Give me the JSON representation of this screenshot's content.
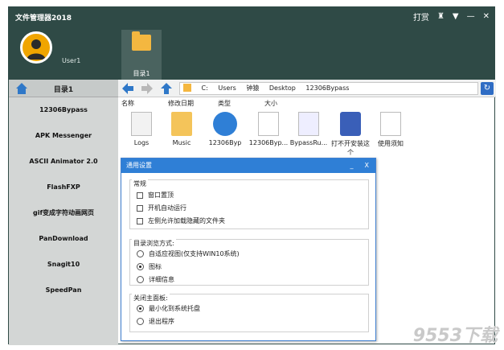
{
  "app": {
    "title": "文件管理器2018",
    "controls": {
      "skin_label": "打赏"
    },
    "user": {
      "name": "User1"
    },
    "tab": {
      "label": "目录1"
    }
  },
  "sidebar": {
    "header": "目录1",
    "items": [
      {
        "label": "12306Bypass"
      },
      {
        "label": "APK Messenger"
      },
      {
        "label": "ASCII Animator 2.0"
      },
      {
        "label": "FlashFXP"
      },
      {
        "label": "gif变成字符动画网页"
      },
      {
        "label": "PanDownload"
      },
      {
        "label": "Snagit10"
      },
      {
        "label": "SpeedPan"
      }
    ]
  },
  "path": {
    "segments": [
      "C:",
      "Users",
      "钟猿",
      "Desktop",
      "12306Bypass"
    ]
  },
  "columns": [
    "名称",
    "修改日期",
    "类型",
    "大小"
  ],
  "files": [
    {
      "name": "Logs",
      "kind": "folder"
    },
    {
      "name": "Music",
      "kind": "folder-open"
    },
    {
      "name": "12306Byp",
      "kind": "app-globe"
    },
    {
      "name": "12306Byp...",
      "kind": "document"
    },
    {
      "name": "BypassRu...",
      "kind": "gear-doc"
    },
    {
      "name": "打不开安装这个",
      "kind": "installer"
    },
    {
      "name": "使用须知",
      "kind": "text"
    }
  ],
  "dialog": {
    "title": "通用设置",
    "min_label": "_",
    "close_label": "X",
    "group1": {
      "title": "常规",
      "options": [
        {
          "label": "窗口置顶",
          "checked": false
        },
        {
          "label": "开机自动运行",
          "checked": false
        },
        {
          "label": "左侧允许加载隐藏的文件夹",
          "checked": false
        }
      ]
    },
    "group2": {
      "title": "目录浏览方式:",
      "options": [
        {
          "label": "自适应视图(仅支持WIN10系统)",
          "selected": false
        },
        {
          "label": "图标",
          "selected": true
        },
        {
          "label": "详细信息",
          "selected": false
        }
      ]
    },
    "group3": {
      "title": "关闭主面板:",
      "options": [
        {
          "label": "最小化到系统托盘",
          "selected": true
        },
        {
          "label": "退出程序",
          "selected": false
        }
      ]
    }
  },
  "watermark": "9553下载"
}
